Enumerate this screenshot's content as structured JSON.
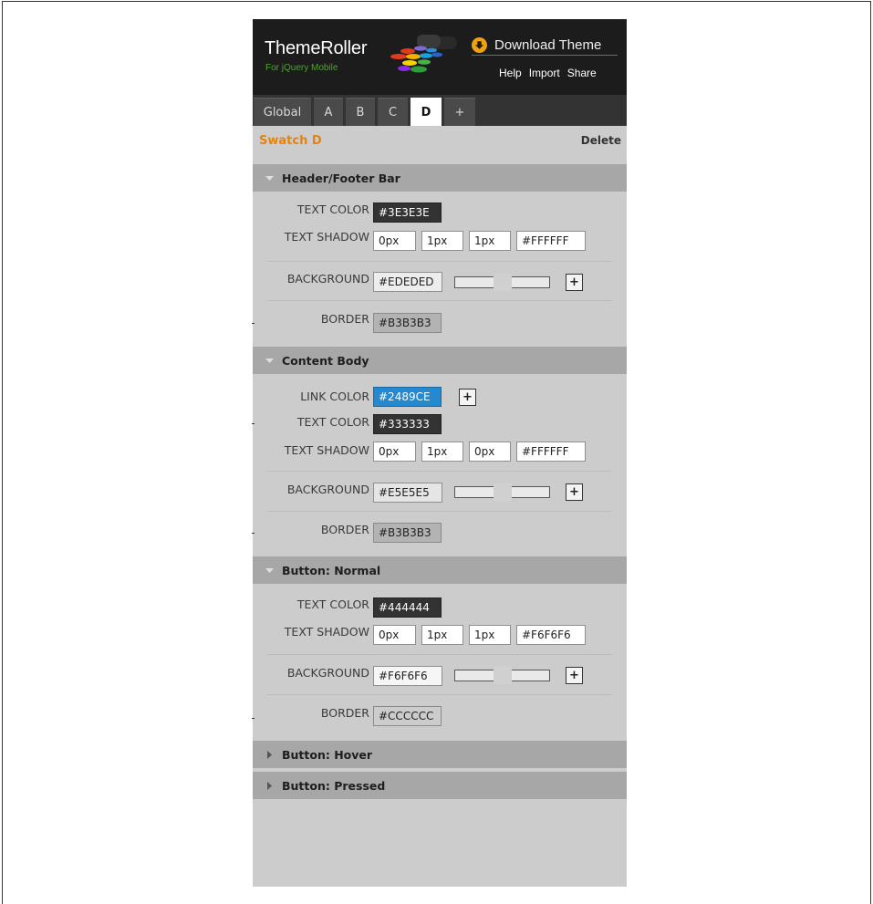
{
  "header": {
    "logo_title": "ThemeRoller",
    "logo_subtitle": "For jQuery Mobile",
    "download_label": "Download Theme",
    "links": [
      "Help",
      "Import",
      "Share"
    ]
  },
  "tabs": [
    {
      "label": "Global",
      "active": false
    },
    {
      "label": "A",
      "active": false
    },
    {
      "label": "B",
      "active": false
    },
    {
      "label": "C",
      "active": false
    },
    {
      "label": "D",
      "active": true
    },
    {
      "label": "+",
      "active": false
    }
  ],
  "swatch": {
    "title": "Swatch D",
    "delete_label": "Delete"
  },
  "sections": {
    "header_footer": {
      "title": "Header/Footer Bar",
      "expanded": true,
      "text_color_label": "TEXT COLOR",
      "text_color": "#3E3E3E",
      "text_shadow_label": "TEXT SHADOW",
      "shadow_x": "0px",
      "shadow_y": "1px",
      "shadow_blur": "1px",
      "shadow_color": "#FFFFFF",
      "background_label": "BACKGROUND",
      "background": "#EDEDED",
      "background_slider": 0.5,
      "add_label": "+",
      "border_label": "BORDER",
      "border": "#B3B3B3"
    },
    "content_body": {
      "title": "Content Body",
      "expanded": true,
      "link_color_label": "LINK COLOR",
      "link_color": "#2489CE",
      "link_add_label": "+",
      "text_color_label": "TEXT COLOR",
      "text_color": "#333333",
      "text_shadow_label": "TEXT SHADOW",
      "shadow_x": "0px",
      "shadow_y": "1px",
      "shadow_blur": "0px",
      "shadow_color": "#FFFFFF",
      "background_label": "BACKGROUND",
      "background": "#E5E5E5",
      "background_slider": 0.5,
      "add_label": "+",
      "border_label": "BORDER",
      "border": "#B3B3B3"
    },
    "button_normal": {
      "title": "Button: Normal",
      "expanded": true,
      "text_color_label": "TEXT COLOR",
      "text_color": "#444444",
      "text_shadow_label": "TEXT SHADOW",
      "shadow_x": "0px",
      "shadow_y": "1px",
      "shadow_blur": "1px",
      "shadow_color": "#F6F6F6",
      "background_label": "BACKGROUND",
      "background": "#F6F6F6",
      "background_slider": 0.5,
      "add_label": "+",
      "border_label": "BORDER",
      "border": "#CCCCCC"
    },
    "button_hover": {
      "title": "Button: Hover",
      "expanded": false
    },
    "button_pressed": {
      "title": "Button: Pressed",
      "expanded": false
    }
  },
  "colors": {
    "accent": "#E8820E",
    "header_bg": "#1C1C1C",
    "panel_bg": "#CCCCCC",
    "section_bg": "#A7A7A7"
  }
}
